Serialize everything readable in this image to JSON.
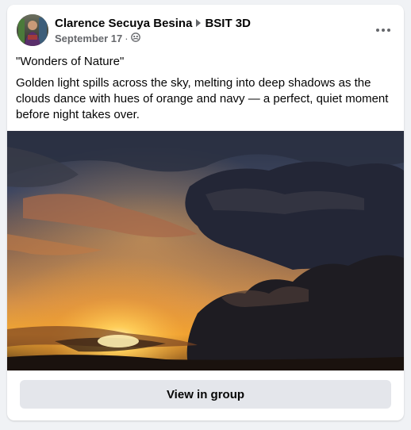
{
  "post": {
    "author": "Clarence Secuya Besina",
    "group": "BSIT 3D",
    "date": "September 17",
    "separator": "·",
    "privacy_icon": "globe-group-icon",
    "more_icon": "more-options-icon",
    "title": "\"Wonders of Nature\"",
    "body": "Golden light spills across the sky, melting into deep shadows as the clouds dance with hues of orange and navy — a perfect, quiet moment before night takes over.",
    "photo_description": "sunset-clouds-photo"
  },
  "actions": {
    "view_in_group": "View in group"
  },
  "colors": {
    "card_background": "#ffffff",
    "page_background": "#f0f2f5",
    "button_background": "#e4e6eb",
    "secondary_text": "#65676b",
    "primary_text": "#050505"
  }
}
